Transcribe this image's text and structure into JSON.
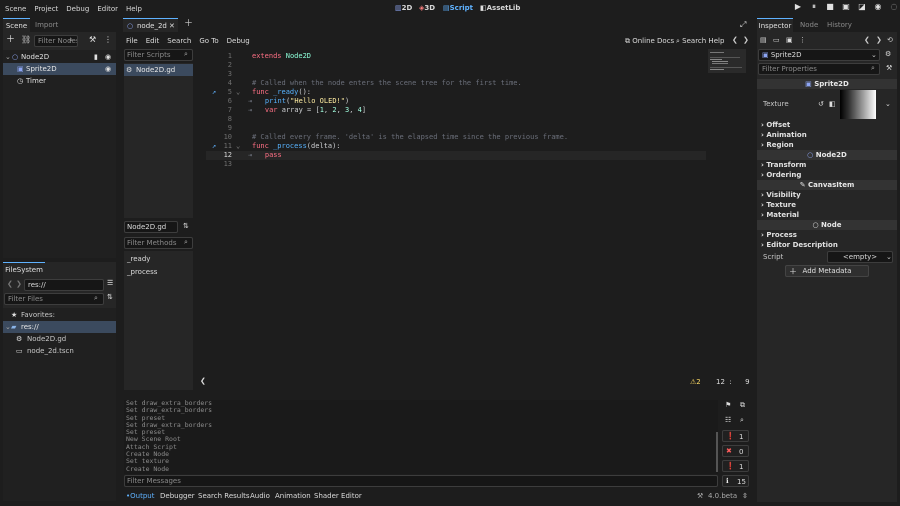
{
  "topbar": {
    "menus": [
      "Scene",
      "Project",
      "Debug",
      "Editor",
      "Help"
    ],
    "workspaces": [
      "2D",
      "3D",
      "Script",
      "AssetLib"
    ],
    "active_workspace": "Script"
  },
  "scene_dock": {
    "tabs": [
      "Scene",
      "Import"
    ],
    "filter_placeholder": "Filter Nodes",
    "nodes": [
      "Node2D",
      "Sprite2D",
      "Timer"
    ],
    "selected": "Sprite2D"
  },
  "filesystem": {
    "tab": "FileSystem",
    "path": "res://",
    "filter_placeholder": "Filter Files",
    "items": [
      "Favorites:",
      "res://",
      "Node2D.gd",
      "node_2d.tscn"
    ]
  },
  "script_editor": {
    "tab": "node_2d",
    "menus": [
      "File",
      "Edit",
      "Search",
      "Go To",
      "Debug"
    ],
    "right_buttons": [
      "Online Docs",
      "Search Help"
    ],
    "filter_scripts_placeholder": "Filter Scripts",
    "scripts": [
      "Node2D.gd"
    ],
    "current_script": "Node2D.gd",
    "filter_methods_placeholder": "Filter Methods",
    "methods": [
      "_ready",
      "_process"
    ],
    "warnings": "2",
    "cursor_line": "12",
    "cursor_sep": ":",
    "cursor_col": "9"
  },
  "code": {
    "line_numbers": [
      "1",
      "2",
      "3",
      "4",
      "5",
      "6",
      "7",
      "8",
      "9",
      "10",
      "11",
      "12",
      "13"
    ],
    "l1a": "extends",
    "l1b": "Node2D",
    "l4": "# Called when the node enters the scene tree for the first time.",
    "l5a": "func",
    "l5b": "_ready",
    "l5c": "():",
    "l6a": "print",
    "l6b": "(",
    "l6c": "\"Hello OLED!\"",
    "l6d": ")",
    "l7a": "var",
    "l7b": "array = [",
    "l7c": "1",
    "l7d": ", ",
    "l7e": "2",
    "l7f": ", ",
    "l7g": "3",
    "l7h": ", ",
    "l7i": "4",
    "l7j": "]",
    "l10": "# Called every frame. 'delta' is the elapsed time since the previous frame.",
    "l11a": "func",
    "l11b": "_process",
    "l11c": "(delta):",
    "l12": "pass",
    "tab_marker": "⇥"
  },
  "output": {
    "lines": [
      "Set draw_extra_borders",
      "Set draw_extra_borders",
      "Set preset",
      "Set draw_extra_borders",
      "Set preset",
      "New Scene Root",
      "Attach Script",
      "Create Node",
      "Set texture",
      "Create Node"
    ],
    "filter_placeholder": "Filter Messages",
    "counts": {
      "log": "1",
      "errors": "0",
      "warnings": "1",
      "messages": "15"
    }
  },
  "bottom_tabs": [
    "Output",
    "Debugger",
    "Search Results",
    "Audio",
    "Animation",
    "Shader Editor"
  ],
  "version": "4.0.beta",
  "inspector": {
    "tabs": [
      "Inspector",
      "Node",
      "History"
    ],
    "object": "Sprite2D",
    "filter_placeholder": "Filter Properties",
    "class_header": "Sprite2D",
    "texture_label": "Texture",
    "sprite_sections": [
      "Offset",
      "Animation",
      "Region"
    ],
    "node2d_header": "Node2D",
    "node2d_sections": [
      "Transform",
      "Ordering"
    ],
    "canvas_header": "CanvasItem",
    "canvas_sections": [
      "Visibility",
      "Texture",
      "Material"
    ],
    "node_header": "Node",
    "node_sections": [
      "Process",
      "Editor Description"
    ],
    "script_label": "Script",
    "script_value": "<empty>",
    "add_metadata": "Add Metadata"
  },
  "colors": {
    "accent": "#5fb2ff",
    "background": "#1d1d1d",
    "panel": "#262626",
    "selection": "#3b4a5e"
  }
}
